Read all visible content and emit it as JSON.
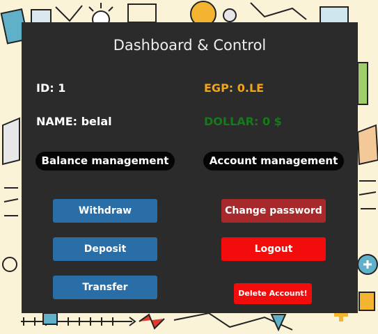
{
  "panel": {
    "title": "Dashboard & Control"
  },
  "account": {
    "id_text": "ID: 1",
    "name_text": "NAME: belal",
    "egp_text": "EGP: 0.LE",
    "dollar_text": "DOLLAR: 0 $"
  },
  "sections": {
    "balance_label": "Balance management",
    "account_label": "Account management"
  },
  "balance_buttons": {
    "withdraw": "Withdraw",
    "deposit": "Deposit",
    "transfer": "Transfer"
  },
  "account_buttons": {
    "change_password": "Change password",
    "logout": "Logout",
    "delete_account": "Delete Account!"
  },
  "colors": {
    "panel_bg": "#2b2b2b",
    "egp": "#f2a516",
    "dollar": "#157a1a",
    "blue_button": "#2a6ea7",
    "change_password_button": "#a8292b",
    "red_button": "#f20c0c"
  }
}
